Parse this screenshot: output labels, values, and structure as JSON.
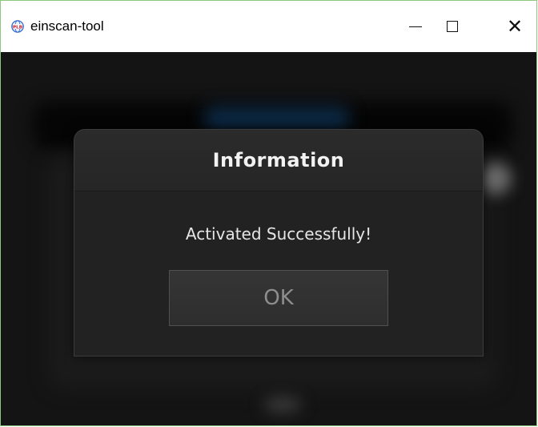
{
  "window": {
    "title": "einscan-tool",
    "icon": "plb-globe-icon",
    "controls": {
      "minimize_icon": "minimize-icon",
      "maximize_icon": "maximize-icon",
      "close_icon": "close-icon"
    }
  },
  "dialog": {
    "title": "Information",
    "message": "Activated Successfully!",
    "ok_label": "OK"
  },
  "colors": {
    "window_border": "#8ec77f",
    "background": "#141414",
    "dialog_bg": "#222222",
    "button_text": "#8e8e8e"
  }
}
